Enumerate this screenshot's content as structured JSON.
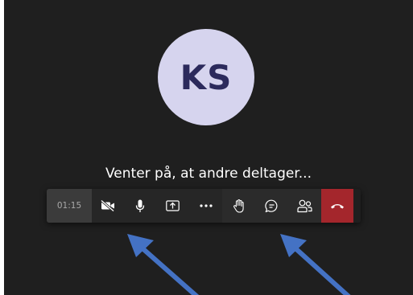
{
  "avatar": {
    "initials": "KS",
    "bg_color": "#d6d4ee",
    "text_color": "#2c2a5c"
  },
  "status_text": "Venter på, at andre deltager...",
  "call_controls": {
    "timer": "01:15",
    "buttons": [
      {
        "name": "camera-off-icon"
      },
      {
        "name": "microphone-icon"
      },
      {
        "name": "share-screen-icon"
      },
      {
        "name": "more-options-icon"
      },
      {
        "name": "raise-hand-icon"
      },
      {
        "name": "chat-icon"
      },
      {
        "name": "participants-icon"
      },
      {
        "name": "hang-up-icon"
      }
    ],
    "hangup_color": "#a4262c"
  },
  "annotations": {
    "arrow_color": "#4472c4"
  }
}
